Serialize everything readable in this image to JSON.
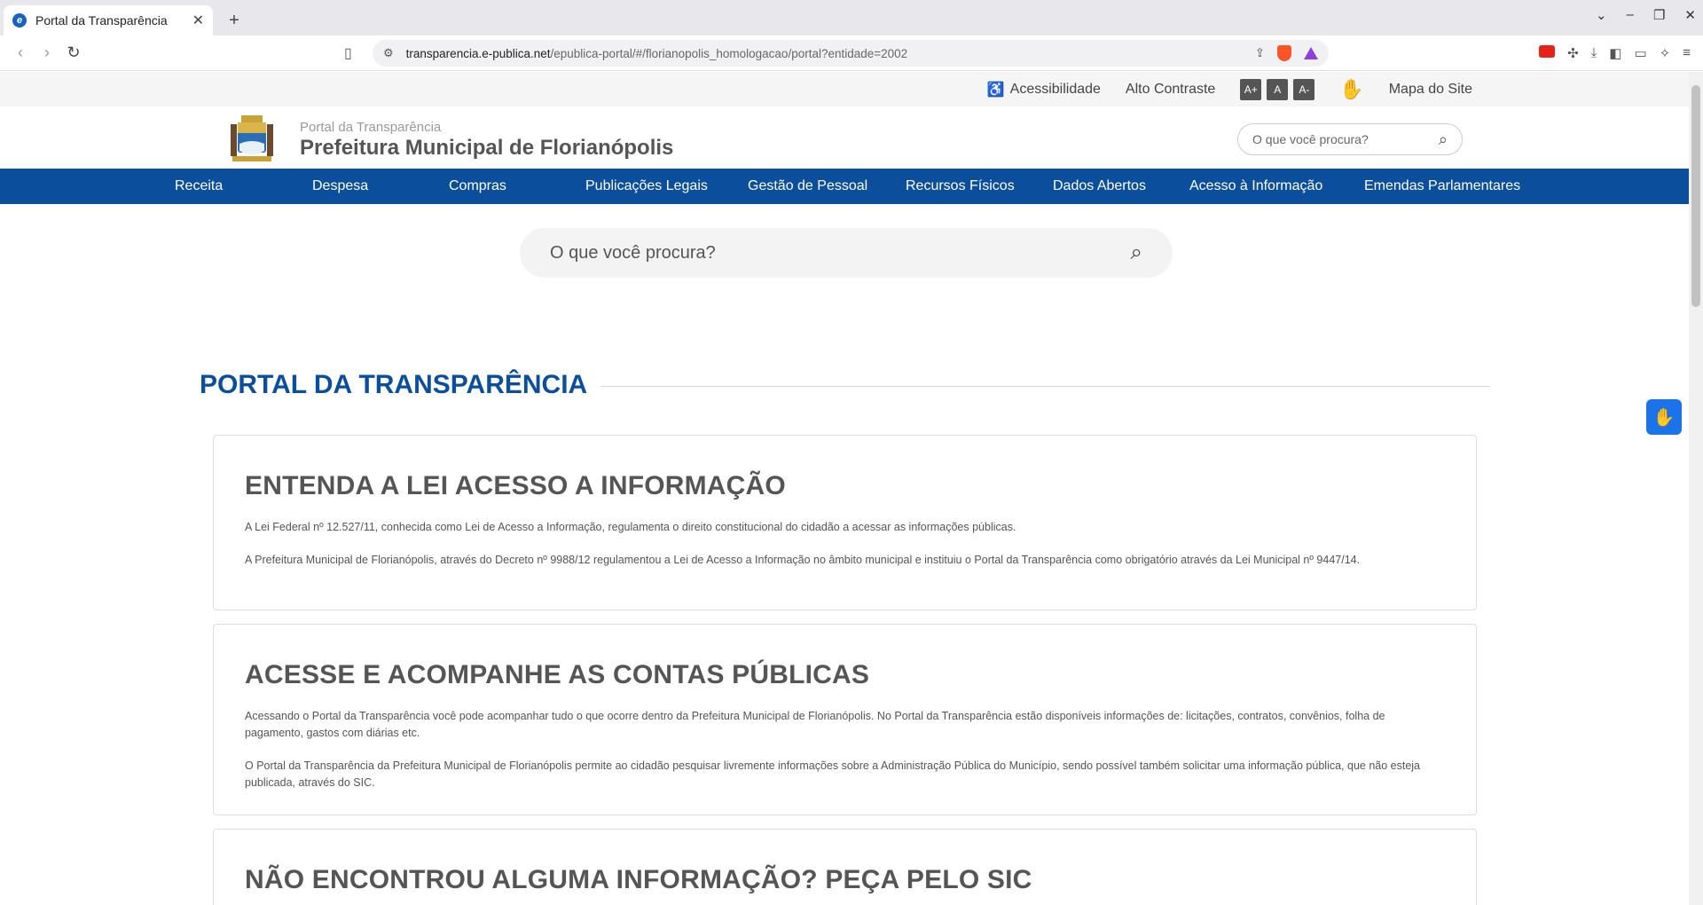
{
  "browser": {
    "tab_title": "Portal da Transparência",
    "url_host": "transparencia.e-publica.net",
    "url_path": "/epublica-portal/#/florianopolis_homologacao/portal?entidade=2002"
  },
  "accessibility_bar": {
    "accessibility_label": "Acessibilidade",
    "contrast_label": "Alto Contraste",
    "font_increase": "A+",
    "font_reset": "A",
    "font_decrease": "A-",
    "sitemap_label": "Mapa do Site"
  },
  "header": {
    "subtitle": "Portal da Transparência",
    "title": "Prefeitura Municipal de Florianópolis",
    "search_placeholder": "O que você procura?"
  },
  "nav": [
    {
      "label": "Receita"
    },
    {
      "label": "Despesa"
    },
    {
      "label": "Compras"
    },
    {
      "label": "Publicações Legais"
    },
    {
      "label": "Gestão de Pessoal"
    },
    {
      "label": "Recursos Físicos"
    },
    {
      "label": "Dados Abertos"
    },
    {
      "label": "Acesso à Informação"
    },
    {
      "label": "Emendas Parlamentares"
    }
  ],
  "main_search": {
    "placeholder": "O que você procura?"
  },
  "section": {
    "title": "PORTAL DA TRANSPARÊNCIA"
  },
  "cards": [
    {
      "title": "ENTENDA A LEI ACESSO A INFORMAÇÃO",
      "paragraphs": [
        "A Lei Federal nº 12.527/11, conhecida como Lei de Acesso a Informação, regulamenta o direito constitucional do cidadão a acessar as informações públicas.",
        "A Prefeitura Municipal de Florianópolis, através do Decreto nº 9988/12 regulamentou a Lei de Acesso a Informação no âmbito municipal e instituiu o Portal da Transparência como obrigatório através da Lei Municipal nº 9447/14."
      ]
    },
    {
      "title": "ACESSE E ACOMPANHE AS CONTAS PÚBLICAS",
      "paragraphs": [
        "Acessando o Portal da Transparência você pode acompanhar tudo o que ocorre dentro da Prefeitura Municipal de Florianópolis. No Portal da Transparência estão disponíveis informações de: licitações, contratos, convênios, folha de pagamento, gastos com diárias etc.",
        "O Portal da Transparência da Prefeitura Municipal de Florianópolis permite ao cidadão pesquisar livremente informações sobre a Administração Pública do Município, sendo possível também solicitar uma informação pública, que não esteja publicada, através do SIC."
      ]
    },
    {
      "title": "NÃO ENCONTROU ALGUMA INFORMAÇÃO? PEÇA PELO SIC"
    }
  ]
}
